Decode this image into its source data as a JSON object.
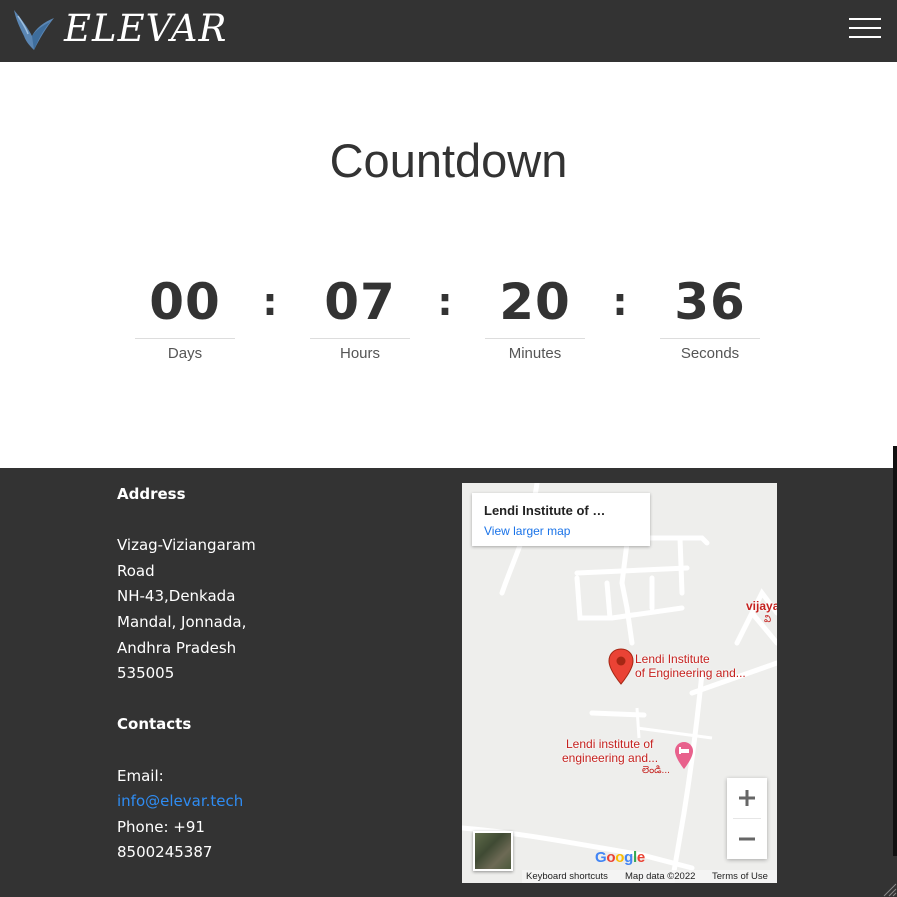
{
  "navbar": {
    "brand": "ELEVAR",
    "logo_icon": "bird-logo-icon",
    "menu_icon": "hamburger-menu-icon"
  },
  "countdown": {
    "title": "Countdown",
    "separator": ":",
    "units": [
      {
        "value": "00",
        "label": "Days"
      },
      {
        "value": "07",
        "label": "Hours"
      },
      {
        "value": "20",
        "label": "Minutes"
      },
      {
        "value": "36",
        "label": "Seconds"
      }
    ]
  },
  "footer": {
    "address_heading": "Address",
    "address_lines": [
      "Vizag-Viziangaram",
      "Road",
      "NH-43,Denkada",
      "Mandal, Jonnada,",
      "Andhra Pradesh",
      "535005"
    ],
    "contacts_heading": "Contacts",
    "email_label": "Email:",
    "email": "info@elevar.tech",
    "phone_lines": [
      "Phone: +91",
      "8500245387"
    ]
  },
  "map": {
    "place_title": "Lendi Institute of …",
    "view_larger": "View larger map",
    "marker_label_lines": [
      "Lendi Institute",
      "of Engineering and..."
    ],
    "poi_label_lines": [
      "Lendi institute of",
      "engineering and...",
      "లెండి..."
    ],
    "edge_label": "vijaya",
    "edge_label_sub": "వి",
    "zoom_in": "+",
    "zoom_out": "−",
    "google": [
      "G",
      "o",
      "o",
      "g",
      "l",
      "e"
    ],
    "footer": {
      "shortcuts": "Keyboard shortcuts",
      "data": "Map data ©2022",
      "terms": "Terms of Use"
    },
    "colors": {
      "marker": "#ea4335",
      "poi": "#c5221f",
      "link": "#1a73e8"
    }
  },
  "colors": {
    "header_bg": "#333333",
    "footer_bg": "#333333",
    "email_link": "#2f8cf2",
    "text_dark": "#333333"
  }
}
